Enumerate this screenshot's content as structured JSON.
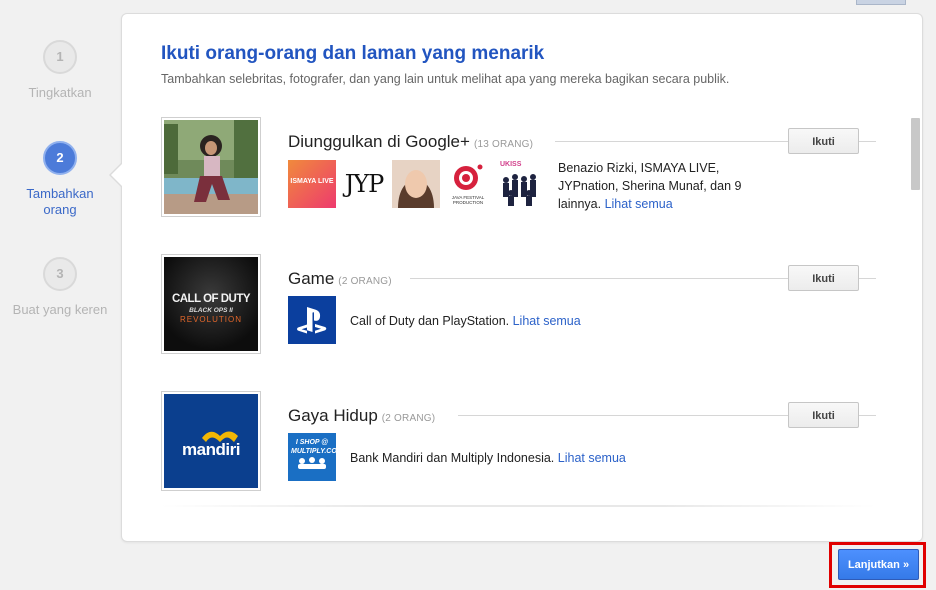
{
  "header": {
    "title": "Ikuti orang-orang dan laman yang menarik",
    "subtitle": "Tambahkan selebritas, fotografer, dan yang lain untuk melihat apa yang mereka bagikan secara publik."
  },
  "steps": [
    {
      "number": "1",
      "label": "Tingkatkan",
      "active": false
    },
    {
      "number": "2",
      "label": "Tambahkan orang",
      "active": true
    },
    {
      "number": "3",
      "label": "Buat yang keren",
      "active": false
    }
  ],
  "categories": [
    {
      "name": "Diunggulkan di Google+",
      "count": "(13 ORANG)",
      "follow_label": "Ikuti",
      "description": "Benazio Rizki, ISMAYA LIVE, JYPnation, Sherina Munaf, dan 9 lainnya.",
      "see_all": "Lihat semua",
      "thumbs": [
        {
          "icon": "ismaya-live-logo",
          "text": "ISMAYA LIVE"
        },
        {
          "icon": "jyp-logo",
          "text": "JYP"
        },
        {
          "icon": "sherina-photo",
          "text": ""
        },
        {
          "icon": "java-festival-logo",
          "text": "JAVA FESTIVAL PRODUCTION"
        },
        {
          "icon": "ukiss-group-photo",
          "text": "UKISS"
        }
      ]
    },
    {
      "name": "Game",
      "count": "(2 ORANG)",
      "follow_label": "Ikuti",
      "description": "Call of Duty dan PlayStation.",
      "see_all": "Lihat semua",
      "cover_text": [
        "CALL OF DUTY",
        "BLACK OPS II",
        "REVOLUTION"
      ],
      "thumbs": [
        {
          "icon": "playstation-logo",
          "text": ""
        }
      ]
    },
    {
      "name": "Gaya Hidup",
      "count": "(2 ORANG)",
      "follow_label": "Ikuti",
      "description": "Bank Mandiri dan Multiply Indonesia.",
      "see_all": "Lihat semua",
      "cover_text": [
        "mandiri"
      ],
      "thumbs": [
        {
          "icon": "multiply-logo",
          "text": "I SHOP @ MULTIPLY.COM"
        }
      ]
    }
  ],
  "footer": {
    "continue_label": "Lanjutkan »"
  },
  "colors": {
    "title": "#2255c0",
    "link": "#2c62c9",
    "active_step": "#4c7bd9",
    "continue_button": "#4d90fe",
    "highlight_frame": "#e00000",
    "mandiri_blue": "#0b3f8e",
    "playstation_blue": "#0b3f9e"
  }
}
